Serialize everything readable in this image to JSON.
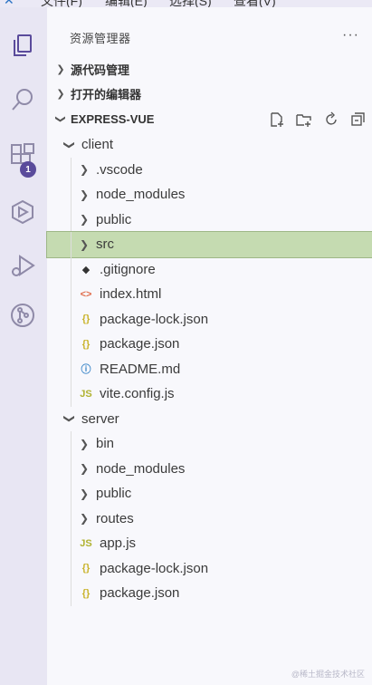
{
  "menubar": {
    "items": [
      "文件(F)",
      "编辑(E)",
      "选择(S)",
      "查看(V)"
    ]
  },
  "activitybar": {
    "icons": [
      "explorer-icon",
      "search-icon",
      "extensions-icon",
      "remote-explorer-icon",
      "run-debug-icon",
      "source-control-icon"
    ],
    "badge": "1"
  },
  "sidebar": {
    "title": "资源管理器",
    "more": "···",
    "sections": [
      {
        "label": "源代码管理"
      },
      {
        "label": "打开的编辑器"
      },
      {
        "label": "EXPRESS-VUE"
      }
    ]
  },
  "tree": [
    {
      "label": "client",
      "type": "folder-open"
    },
    {
      "label": ".vscode",
      "type": "folder"
    },
    {
      "label": "node_modules",
      "type": "folder"
    },
    {
      "label": "public",
      "type": "folder"
    },
    {
      "label": "src",
      "type": "folder"
    },
    {
      "label": ".gitignore",
      "type": "git"
    },
    {
      "label": "index.html",
      "type": "html"
    },
    {
      "label": "package-lock.json",
      "type": "json"
    },
    {
      "label": "package.json",
      "type": "json"
    },
    {
      "label": "README.md",
      "type": "info"
    },
    {
      "label": "vite.config.js",
      "type": "js"
    },
    {
      "label": "server",
      "type": "folder-open"
    },
    {
      "label": "bin",
      "type": "folder"
    },
    {
      "label": "node_modules",
      "type": "folder"
    },
    {
      "label": "public",
      "type": "folder"
    },
    {
      "label": "routes",
      "type": "folder"
    },
    {
      "label": "app.js",
      "type": "js"
    },
    {
      "label": "package-lock.json",
      "type": "json"
    },
    {
      "label": "package.json",
      "type": "json"
    }
  ],
  "icon_glyphs": {
    "git": "◆",
    "html": "<>",
    "json": "{}",
    "info": "ⓘ",
    "js": "JS"
  },
  "colors": {
    "selected_row": "#c5dbb1",
    "badge": "#5a4b9b",
    "json": "#c9b32b",
    "html": "#e06c4b",
    "js": "#b0b230",
    "info": "#3a86c8"
  },
  "watermark": "@稀土掘金技术社区"
}
